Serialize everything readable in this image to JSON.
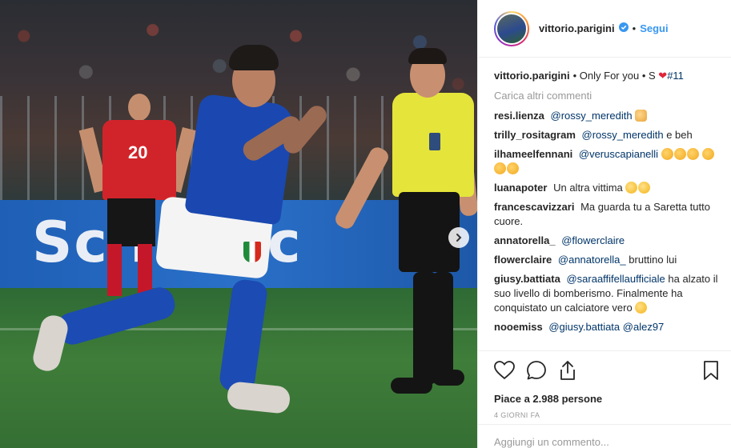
{
  "photo": {
    "board_text": "Sc   i se  c",
    "player_number": "20"
  },
  "header": {
    "username": "vittorio.parigini",
    "separator": "•",
    "follow_label": "Segui"
  },
  "caption": {
    "username": "vittorio.parigini",
    "text": "• Only For you • S",
    "hashtag": "#11"
  },
  "load_more": "Carica altri commenti",
  "comments": [
    {
      "user": "resi.lienza",
      "mention": "@rossy_meredith",
      "text": ""
    },
    {
      "user": "trilly_rositagram",
      "mention": "@rossy_meredith",
      "text": "e beh"
    },
    {
      "user": "ilhameelfennani",
      "mention": "@veruscapianelli",
      "text": ""
    },
    {
      "user": "luanapoter",
      "mention": "",
      "text": "Un altra vittima"
    },
    {
      "user": "francescavizzari",
      "mention": "",
      "text": "Ma guarda tu a Saretta tutto cuore."
    },
    {
      "user": "annatorella_",
      "mention": "@flowerclaire",
      "text": ""
    },
    {
      "user": "flowerclaire",
      "mention": "@annatorella_",
      "text": "bruttino lui"
    },
    {
      "user": "giusy.battiata",
      "mention": "@saraaffifellaufficiale",
      "text": "ha alzato il suo livello di bomberismo. Finalmente ha conquistato un calciatore vero"
    },
    {
      "user": "nooemiss",
      "mention": "@giusy.battiata",
      "mention2": "@alez97",
      "text": ""
    }
  ],
  "likes_text": "Piace a 2.988 persone",
  "time_ago": "4 GIORNI FA",
  "add_comment_placeholder": "Aggiungi un commento...",
  "colors": {
    "link_blue": "#3897f0",
    "mention_blue": "#003569",
    "heart_red": "#e0253a",
    "muted_gray": "#999999"
  }
}
